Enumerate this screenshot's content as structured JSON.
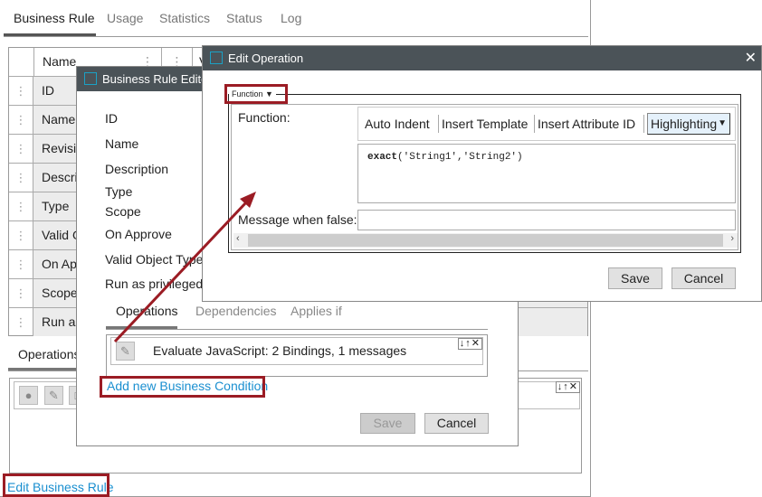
{
  "main": {
    "tabs": [
      "Business Rule",
      "Usage",
      "Statistics",
      "Status",
      "Log"
    ],
    "table": {
      "headers": [
        "Name",
        "V"
      ],
      "rows": [
        "ID",
        "Name",
        "Revisio",
        "Descri",
        "Type",
        "Valid O",
        "On Ap",
        "Scope",
        "Run as"
      ]
    },
    "ops_tab": "Operations",
    "edit_link": "Edit Business Rule"
  },
  "rule_editor": {
    "title": "Business Rule Editor -",
    "fields": [
      "ID",
      "Name",
      "Description",
      "Type",
      "Scope",
      "On Approve",
      "Valid Object Type",
      "Run as privileged"
    ],
    "tabs": [
      "Operations",
      "Dependencies",
      "Applies if"
    ],
    "operation": "Evaluate JavaScript: 2 Bindings, 1 messages",
    "add_link": "Add new Business Condition",
    "save": "Save",
    "cancel": "Cancel"
  },
  "edit_operation": {
    "title": "Edit Operation",
    "legend": "Function",
    "function_label": "Function:",
    "toolbar": [
      "Auto Indent",
      "Insert Template",
      "Insert Attribute ID"
    ],
    "highlighting": "Highlighting",
    "code_fn": "exact",
    "code_args": "('String1','String2')",
    "message_label": "Message when false:",
    "message_value": "",
    "save": "Save",
    "cancel": "Cancel"
  },
  "colors": {
    "annotation": "#9b1c24",
    "titlebar": "#4b5358",
    "link": "#1a8fd0"
  }
}
